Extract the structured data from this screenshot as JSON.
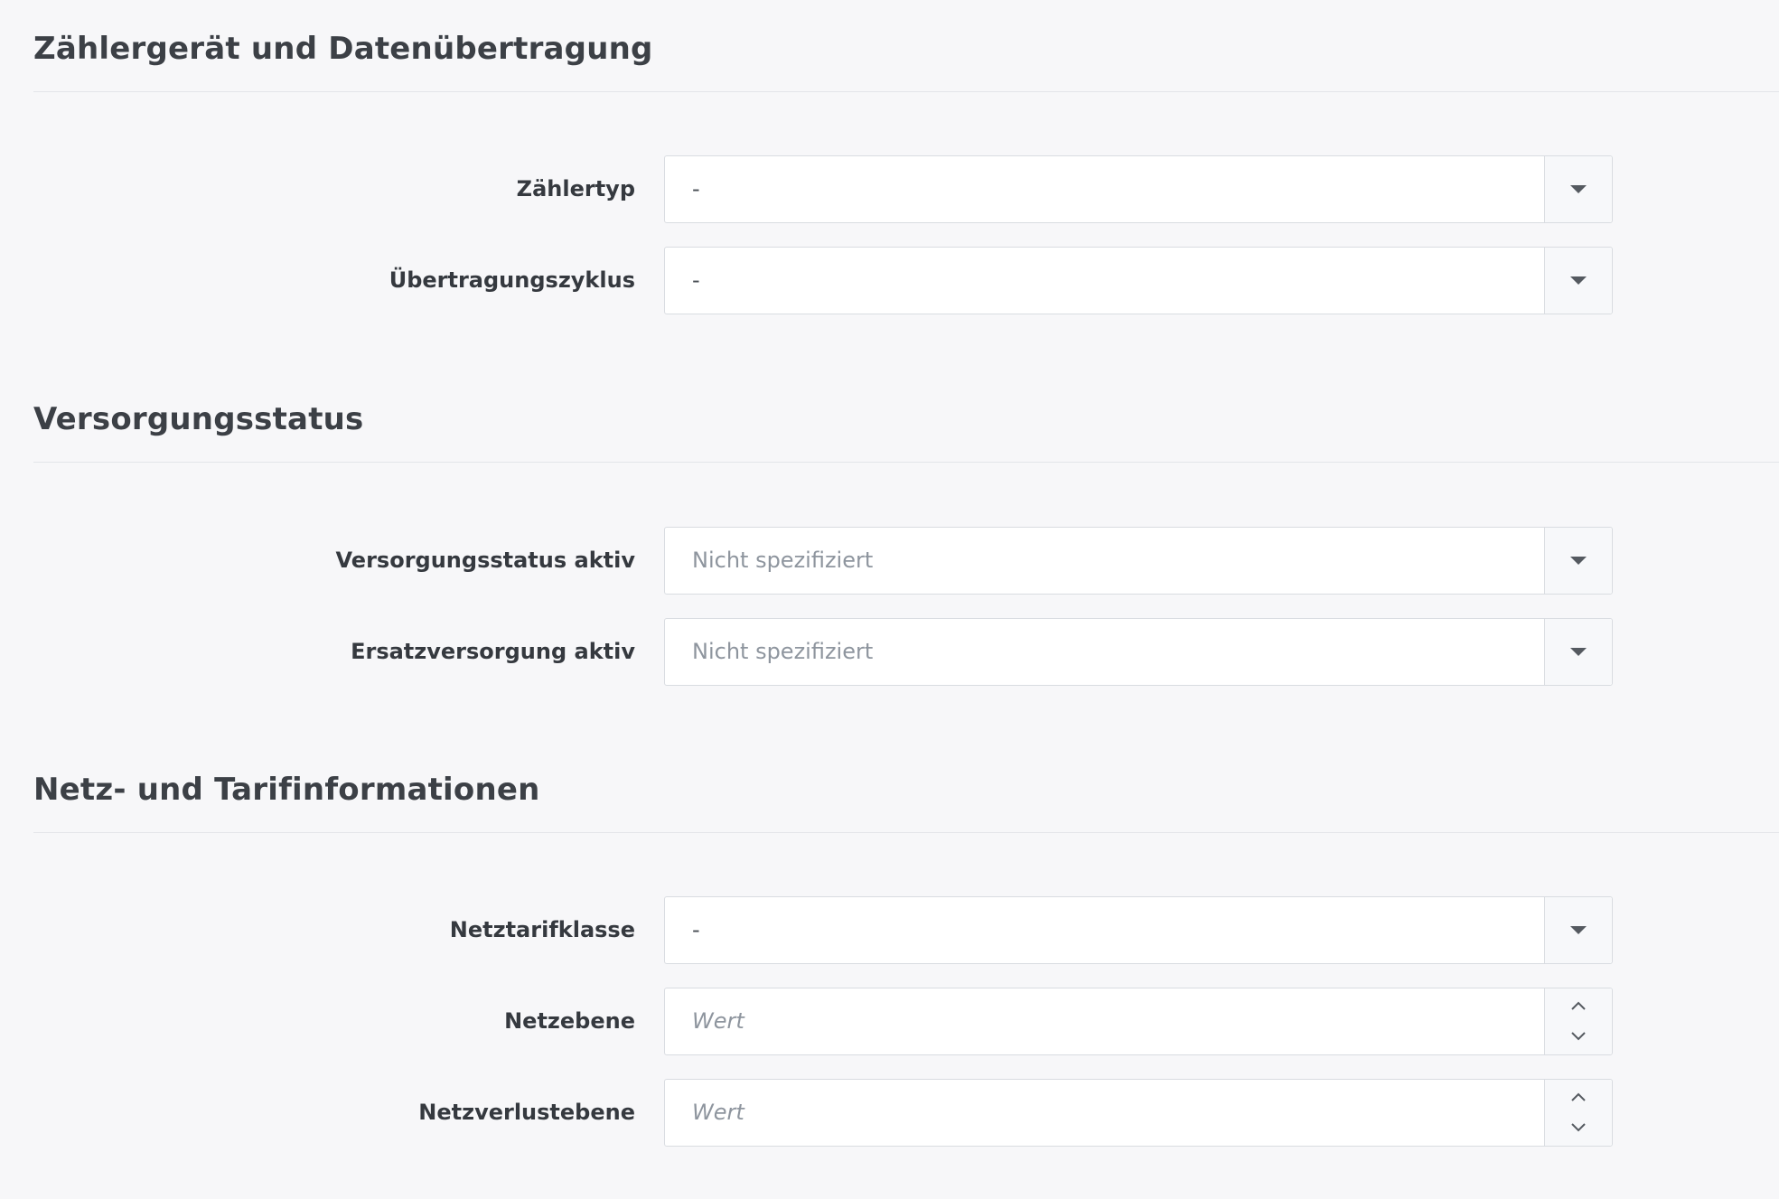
{
  "sections": [
    {
      "title": "Zählergerät und Datenübertragung",
      "fields": [
        {
          "label": "Zählertyp",
          "value": "-",
          "kind": "select"
        },
        {
          "label": "Übertragungszyklus",
          "value": "-",
          "kind": "select"
        }
      ]
    },
    {
      "title": "Versorgungsstatus",
      "fields": [
        {
          "label": "Versorgungsstatus aktiv",
          "value": "Nicht spezifiziert",
          "kind": "select"
        },
        {
          "label": "Ersatzversorgung aktiv",
          "value": "Nicht spezifiziert",
          "kind": "select"
        }
      ]
    },
    {
      "title": "Netz- und Tarifinformationen",
      "fields": [
        {
          "label": "Netztarifklasse",
          "value": "-",
          "kind": "select"
        },
        {
          "label": "Netzebene",
          "placeholder": "Wert",
          "kind": "number"
        },
        {
          "label": "Netzverlustebene",
          "placeholder": "Wert",
          "kind": "number"
        }
      ]
    }
  ],
  "icons": {
    "select_caret": "caret-down-icon",
    "spin_up": "chevron-up-icon",
    "spin_down": "chevron-down-icon"
  },
  "colors": {
    "background": "#f7f7f9",
    "control_border": "#d9dce1",
    "placeholder": "#8e959e"
  }
}
